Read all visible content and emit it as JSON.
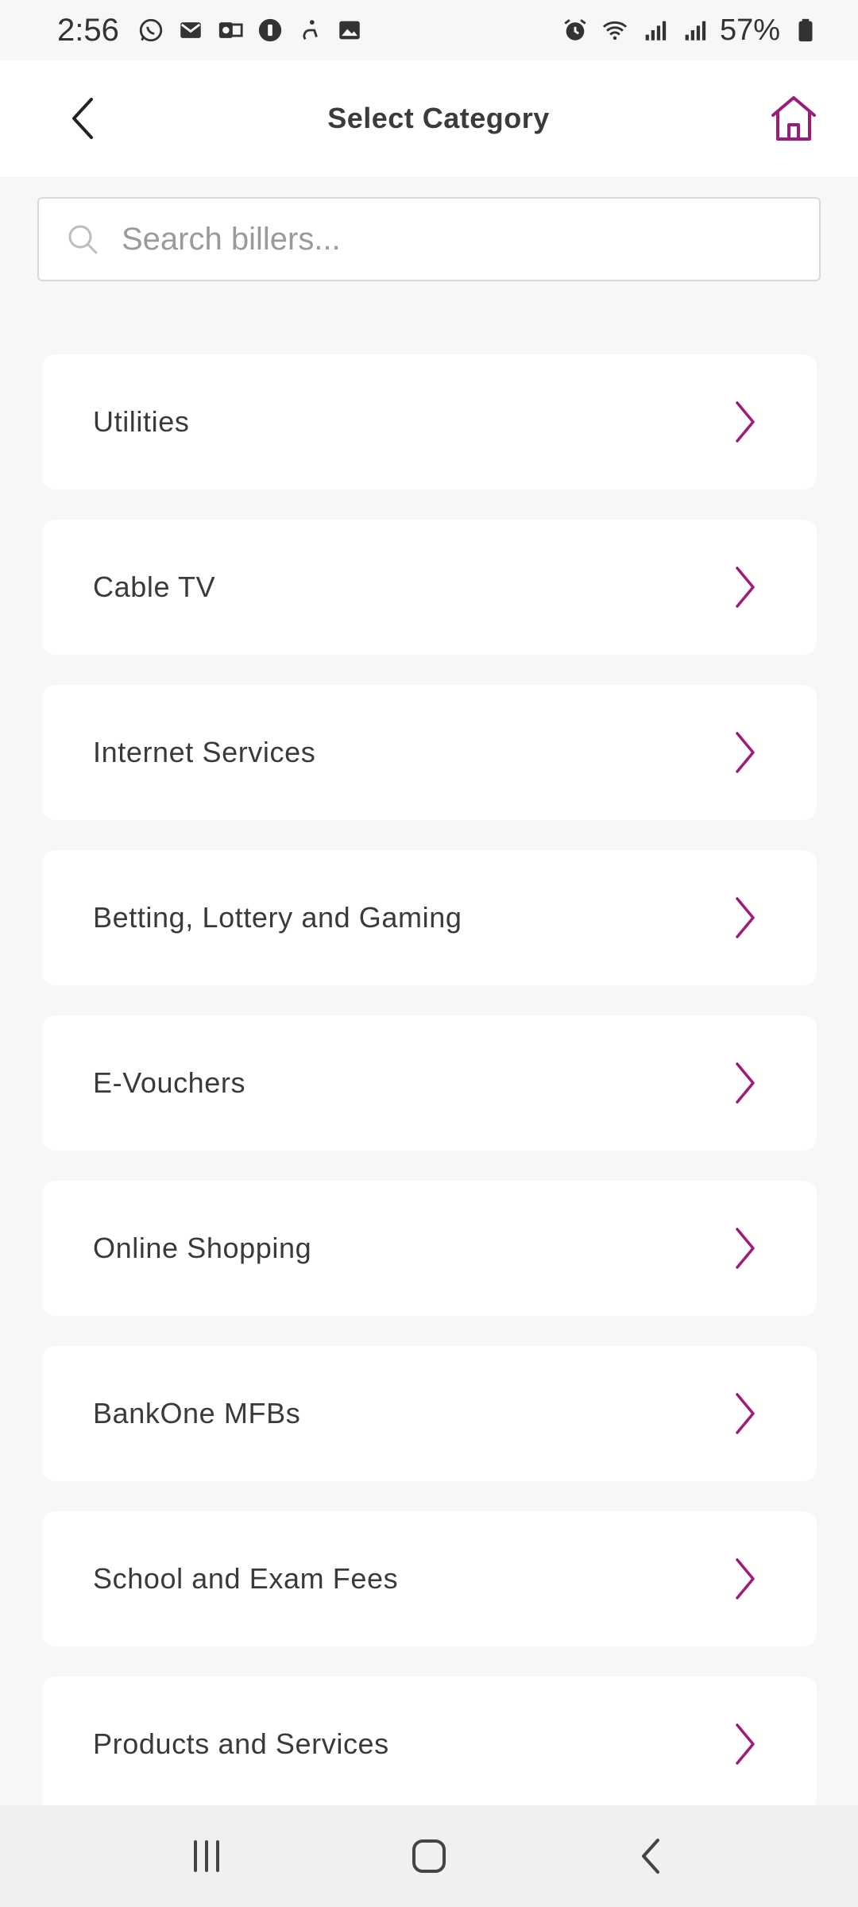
{
  "status_bar": {
    "time": "2:56",
    "battery": "57%",
    "left_icons": [
      "whatsapp-icon",
      "mail-icon",
      "outlook-icon",
      "security-icon",
      "accessibility-icon",
      "gallery-icon"
    ],
    "right_icons": [
      "alarm-icon",
      "wifi-icon",
      "signal-icon",
      "signal-icon",
      "battery-icon"
    ]
  },
  "header": {
    "title": "Select Category",
    "back_icon": "chevron-left-icon",
    "home_icon": "home-icon"
  },
  "search": {
    "placeholder": "Search billers...",
    "value": ""
  },
  "categories": [
    {
      "label": "Utilities"
    },
    {
      "label": "Cable TV"
    },
    {
      "label": "Internet Services"
    },
    {
      "label": "Betting, Lottery and Gaming"
    },
    {
      "label": "E-Vouchers"
    },
    {
      "label": "Online Shopping"
    },
    {
      "label": "BankOne MFBs"
    },
    {
      "label": "School and Exam Fees"
    },
    {
      "label": "Products and Services"
    }
  ],
  "colors": {
    "accent": "#9c1c7c",
    "background": "#f7f7f7",
    "card": "#ffffff"
  },
  "nav_bar": {
    "icons": [
      "recent-apps-icon",
      "home-circle-icon",
      "back-icon"
    ]
  }
}
